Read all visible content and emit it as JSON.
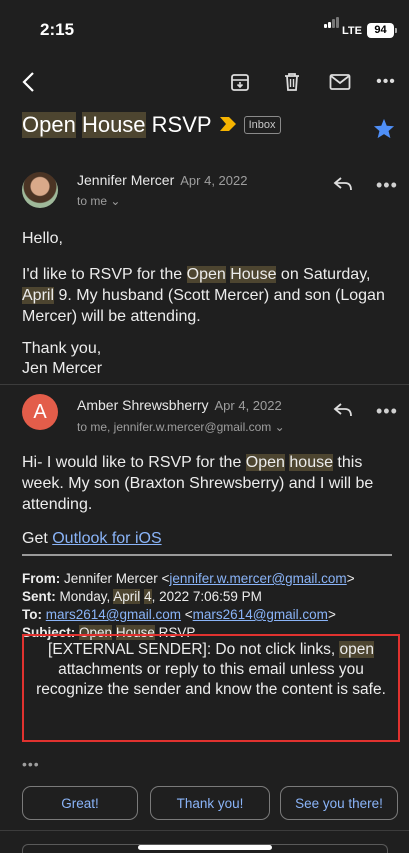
{
  "status": {
    "time": "2:15",
    "network": "LTE",
    "battery": "94"
  },
  "toolbar": {
    "back_icon": "back-arrow",
    "archive_icon": "archive",
    "delete_icon": "trash",
    "mark_unread_icon": "envelope",
    "more_icon": "more-horizontal"
  },
  "subject": {
    "word1": "Open",
    "word2": "House",
    "word3": "RSVP",
    "label": "Inbox",
    "starred": true
  },
  "message1": {
    "avatar_icon": "profile-photo",
    "sender": "Jennifer Mercer",
    "date": "Apr 4, 2022",
    "to": "to me",
    "greeting": "Hello,",
    "p1_a": "I'd like to RSVP for the ",
    "p1_open": "Open",
    "p1_house": "House",
    "p1_b": " on Saturday, ",
    "p1_april": "April",
    "p1_c": " 9.  My husband (Scott Mercer) and son (Logan Mercer) will be attending.",
    "thanks": "Thank you,",
    "signoff": "Jen Mercer"
  },
  "message2": {
    "avatar_letter": "A",
    "sender": "Amber Shrewsbherry",
    "date": "Apr 4, 2022",
    "to": "to me, jennifer.w.mercer@gmail.com",
    "p1_a": "Hi- I would like to RSVP for the ",
    "p1_open": "Open",
    "p1_house": "house",
    "p1_b": " this week. My son (Braxton Shrewsberry) and I will be attending.",
    "get": "Get ",
    "outlook_link": "Outlook for iOS",
    "from_label": "From:",
    "from_value": " Jennifer Mercer <",
    "from_email": "jennifer.w.mercer@gmail.com",
    "from_end": ">",
    "sent_label": "Sent:",
    "sent_a": " Monday, ",
    "sent_april": "April",
    "sent_b": " ",
    "sent_4": "4",
    "sent_c": ", 2022 7:06:59 PM",
    "to_label": "To:",
    "to_email1": "mars2614@gmail.com",
    "to_mid": " <",
    "to_email2": "mars2614@gmail.com",
    "to_end": ">",
    "subj_label": "Subject:",
    "subj_open": "Open",
    "subj_house": "House",
    "subj_rsvp": " RSVP",
    "warning_a": "[EXTERNAL SENDER]: Do not click links, ",
    "warning_open": "open",
    "warning_b": " attachments or reply to this email unless you recognize the sender and know the content is safe.",
    "quoted_toggle": "•••"
  },
  "smart_replies": [
    "Great!",
    "Thank you!",
    "See you there!"
  ],
  "colors": {
    "background": "#1f1f1f",
    "accent": "#8ab4f8",
    "highlight": "#4d4530",
    "warning_border": "#e0322f",
    "avatar_a": "#e35d4a",
    "star": "#4f8ff7",
    "important": "#f6b400"
  }
}
